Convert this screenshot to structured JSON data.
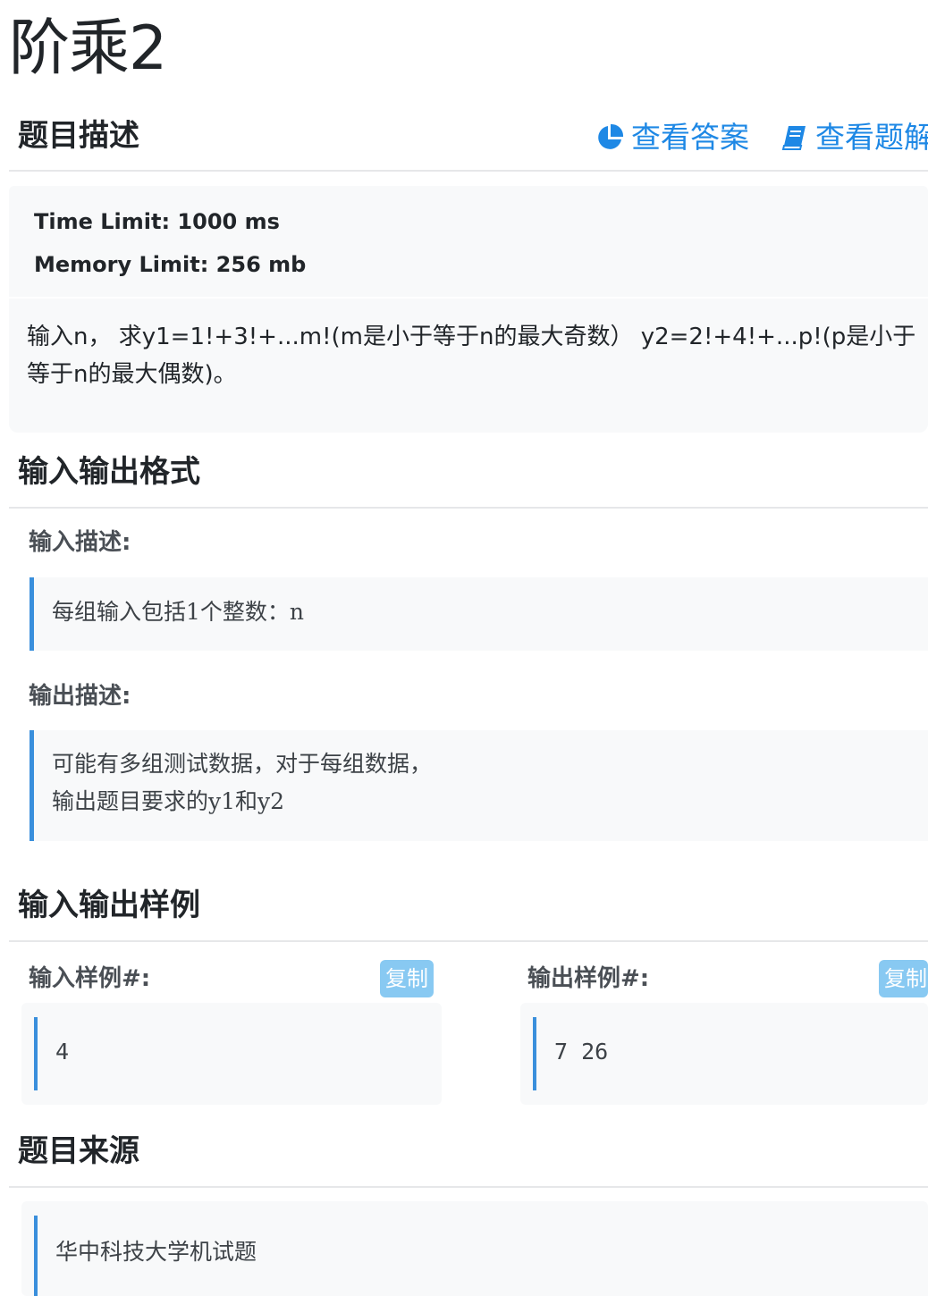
{
  "page": {
    "title": "阶乘2"
  },
  "description_section": {
    "title": "题目描述",
    "actions": [
      {
        "label": "查看答案",
        "icon": "pie-chart-icon"
      },
      {
        "label": "查看题解",
        "icon": "book-icon"
      }
    ],
    "time_limit": "Time Limit: 1000 ms",
    "memory_limit": "Memory Limit: 256 mb",
    "text": "输入n， 求y1=1!+3!+...m!(m是小于等于n的最大奇数） y2=2!+4!+...p!(p是小于等于n的最大偶数)。"
  },
  "io_format": {
    "title": "输入输出格式",
    "input_label": "输入描述:",
    "input_text": "每组输入包括1个整数：n",
    "output_label": "输出描述:",
    "output_text": "可能有多组测试数据，对于每组数据，\n输出题目要求的y1和y2"
  },
  "samples": {
    "title": "输入输出样例",
    "input_label": "输入样例#:",
    "output_label": "输出样例#:",
    "copy_label": "复制",
    "input_value": "4",
    "output_value": "7 26"
  },
  "source": {
    "title": "题目来源",
    "text": "华中科技大学机试题"
  },
  "colors": {
    "accent": "#1e88e5",
    "quote_border": "#3a8fdc",
    "copy_button": "#88c9f2"
  }
}
